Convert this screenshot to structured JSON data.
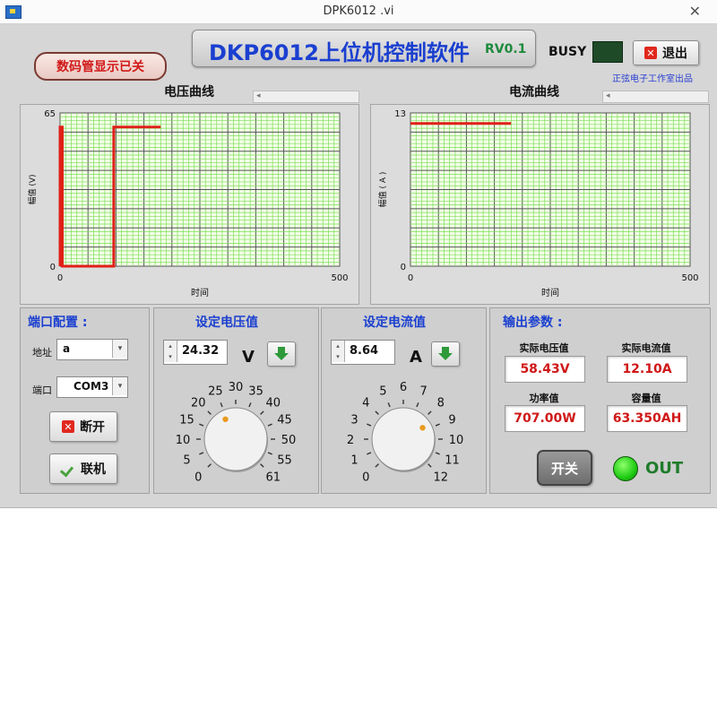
{
  "window": {
    "title": "DPK6012 .vi",
    "close_glyph": "✕",
    "app_icon": "labview-icon"
  },
  "header": {
    "title": "DKP6012上位机控制软件",
    "version": "RV0.1",
    "display_toggle": "数码管显示已关",
    "busy_label": "BUSY",
    "exit_label": "退出",
    "credit": "正弦电子工作室出品"
  },
  "voltage_chart": {
    "title": "电压曲线",
    "ylabel": "幅值 (V)",
    "xlabel": "时间",
    "chart_data": {
      "type": "line",
      "title": "电压曲线",
      "xlabel": "时间",
      "ylabel": "幅值 (V)",
      "xlim": [
        0,
        500
      ],
      "ylim": [
        0,
        65
      ],
      "x_ticks": [
        0,
        500
      ],
      "y_ticks": [
        0,
        65
      ],
      "grid": true,
      "color": "#e02018",
      "x": [
        0,
        0,
        4,
        4,
        14,
        17,
        17,
        96,
        96,
        98,
        98,
        180,
        180
      ],
      "y": [
        0,
        59,
        59,
        0,
        0,
        0,
        0,
        0,
        59,
        59,
        59,
        59,
        59
      ]
    }
  },
  "current_chart": {
    "title": "电流曲线",
    "ylabel": "幅值 ( A )",
    "xlabel": "时间",
    "chart_data": {
      "type": "line",
      "title": "电流曲线",
      "xlabel": "时间",
      "ylabel": "幅值 ( A )",
      "xlim": [
        0,
        500
      ],
      "ylim": [
        0,
        13
      ],
      "x_ticks": [
        0,
        500
      ],
      "y_ticks": [
        0,
        13
      ],
      "grid": true,
      "color": "#e02018",
      "x": [
        0,
        180
      ],
      "y": [
        12.1,
        12.1
      ]
    }
  },
  "port": {
    "title": "端口配置 :",
    "address_label": "地址",
    "address_value": "a",
    "port_label": "端口",
    "port_value": "COM3",
    "disconnect_label": "断开",
    "connect_label": "联机"
  },
  "voltage_set": {
    "title": "设定电压值",
    "value": "24.32",
    "unit": "V",
    "knob_labels": [
      "0",
      "5",
      "10",
      "15",
      "20",
      "25",
      "30",
      "35",
      "40",
      "45",
      "50",
      "55",
      "61"
    ],
    "knob_min": 0,
    "knob_max": 61,
    "knob_value": 24.32
  },
  "current_set": {
    "title": "设定电流值",
    "value": "8.64",
    "unit": "A",
    "knob_labels": [
      "0",
      "1",
      "2",
      "3",
      "4",
      "5",
      "6",
      "7",
      "8",
      "9",
      "10",
      "11",
      "12"
    ],
    "knob_min": 0,
    "knob_max": 12,
    "knob_value": 8.64
  },
  "output": {
    "title": "输出参数 :",
    "voltage_label": "实际电压值",
    "voltage_value": "58.43V",
    "current_label": "实际电流值",
    "current_value": "12.10A",
    "power_label": "功率值",
    "power_value": "707.00W",
    "capacity_label": "容量值",
    "capacity_value": "63.350AH",
    "power_button": "开关",
    "out_label": "OUT"
  },
  "colors": {
    "accent_blue": "#1a3fd0",
    "value_red": "#d01818",
    "led_green": "#1fcc14",
    "grid_green": "#7fdc5a",
    "plot_bg": "#f3ffe8"
  }
}
